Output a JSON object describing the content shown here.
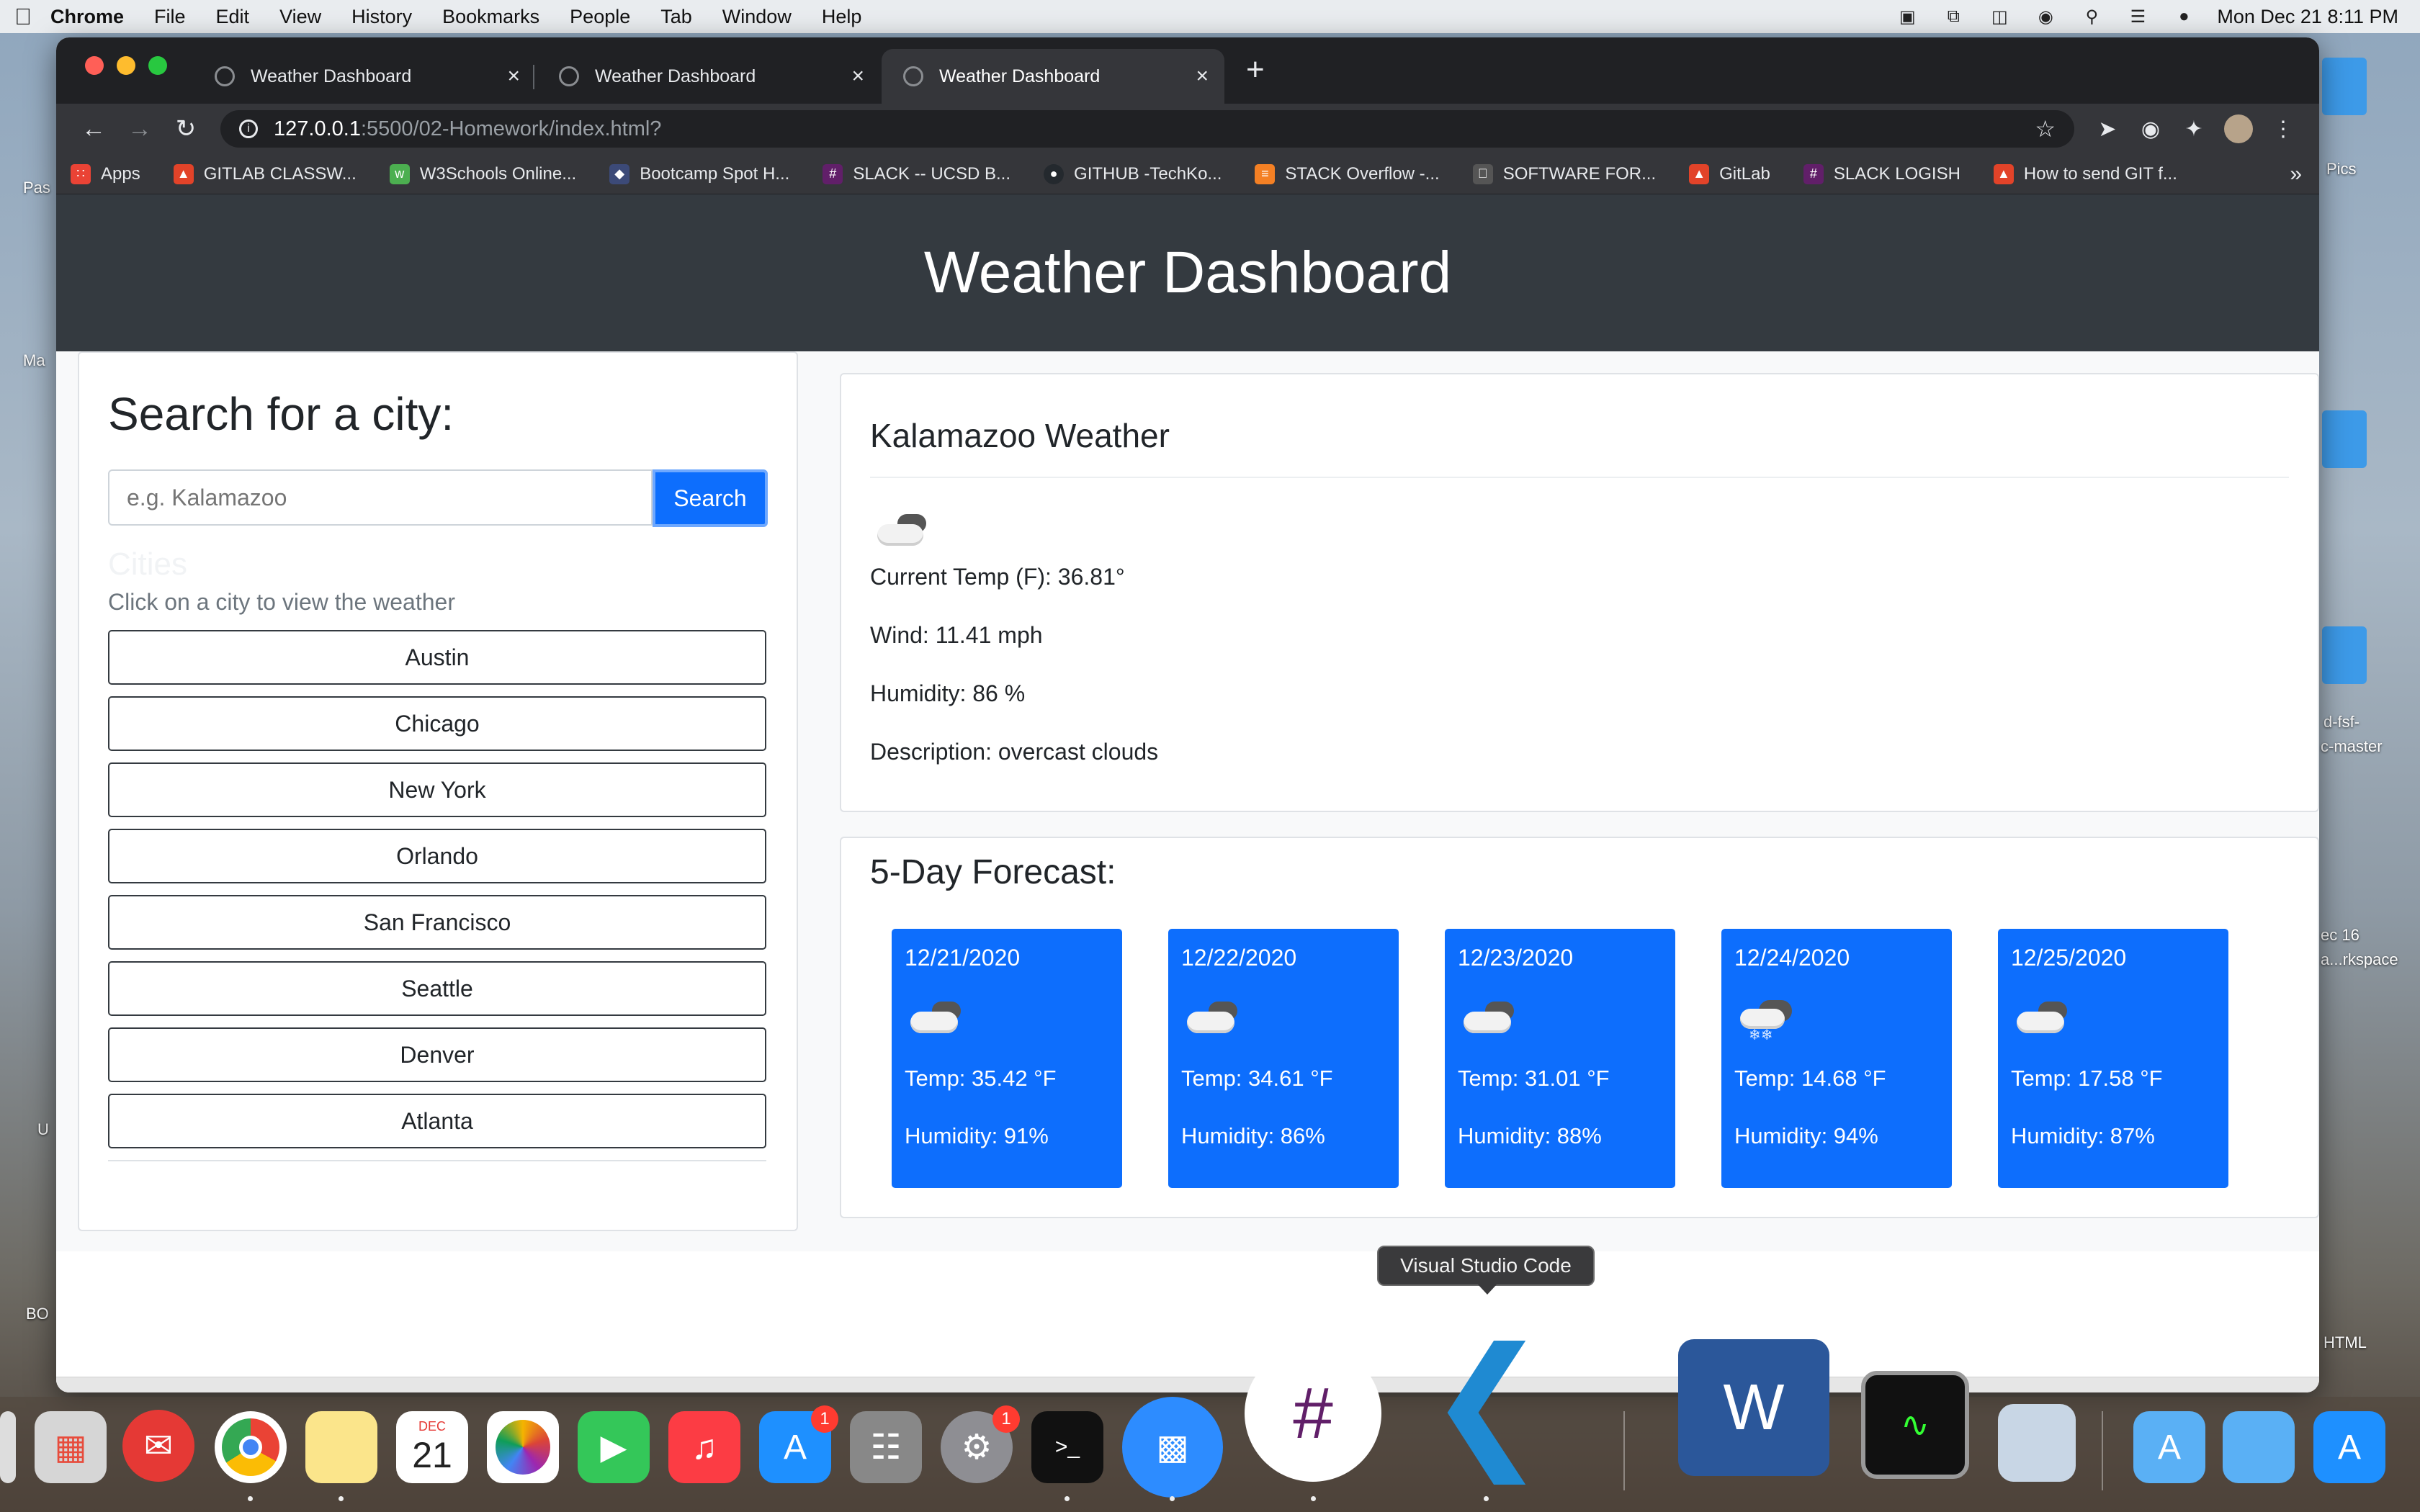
{
  "menubar": {
    "app": "Chrome",
    "items": [
      "File",
      "Edit",
      "View",
      "History",
      "Bookmarks",
      "People",
      "Tab",
      "Window",
      "Help"
    ],
    "clock": "Mon Dec 21  8:11 PM"
  },
  "desktop": {
    "labels": [
      "Pas",
      "Ma",
      "U",
      "BO",
      "Pics",
      "d-fsf-",
      "c-master",
      "ec 16",
      "a...rkspace",
      "HTML"
    ]
  },
  "browser": {
    "tabs": [
      {
        "title": "Weather Dashboard"
      },
      {
        "title": "Weather Dashboard"
      },
      {
        "title": "Weather Dashboard"
      }
    ],
    "url_host": "127.0.0.1",
    "url_path": ":5500/02-Homework/index.html?",
    "bookmarks": [
      {
        "label": "Apps",
        "icon": "apps-grid-icon",
        "color": "#ea4335"
      },
      {
        "label": "GITLAB CLASSW...",
        "icon": "gitlab-icon",
        "color": "#e24329"
      },
      {
        "label": "W3Schools Online...",
        "icon": "w3schools-icon",
        "color": "#4caf50"
      },
      {
        "label": "Bootcamp Spot H...",
        "icon": "shield-icon",
        "color": "#3c4a78"
      },
      {
        "label": "SLACK -- UCSD B...",
        "icon": "slack-icon",
        "color": "#611f69"
      },
      {
        "label": "GITHUB -TechKo...",
        "icon": "github-icon",
        "color": "#24292e"
      },
      {
        "label": "STACK Overflow -...",
        "icon": "stackoverflow-icon",
        "color": "#f48024"
      },
      {
        "label": "SOFTWARE FOR...",
        "icon": "apple-icon",
        "color": "#555555"
      },
      {
        "label": "GitLab",
        "icon": "gitlab-icon",
        "color": "#e24329"
      },
      {
        "label": "SLACK LOGISH",
        "icon": "slack-icon",
        "color": "#611f69"
      },
      {
        "label": "How to send GIT f...",
        "icon": "gitlab-icon",
        "color": "#e24329"
      }
    ]
  },
  "page": {
    "header_title": "Weather Dashboard",
    "search": {
      "title": "Search for a city:",
      "placeholder": "e.g. Kalamazoo",
      "button_label": "Search",
      "cities_heading": "Cities",
      "help_text": "Click on a city to view the weather",
      "cities": [
        "Austin",
        "Chicago",
        "New York",
        "Orlando",
        "San Francisco",
        "Seattle",
        "Denver",
        "Atlanta"
      ]
    },
    "current": {
      "title": "Kalamazoo Weather",
      "icon": "overcast-clouds-icon",
      "temp": "Current Temp (F): 36.81°",
      "wind": "Wind: 11.41 mph",
      "humidity": "Humidity: 86 %",
      "description": "Description: overcast clouds"
    },
    "forecast": {
      "title": "5-Day Forecast:",
      "days": [
        {
          "date": "12/21/2020",
          "icon": "overcast-clouds-icon",
          "temp": "Temp: 35.42 °F",
          "humidity": "Humidity: 91%"
        },
        {
          "date": "12/22/2020",
          "icon": "overcast-clouds-icon",
          "temp": "Temp: 34.61 °F",
          "humidity": "Humidity: 86%"
        },
        {
          "date": "12/23/2020",
          "icon": "overcast-clouds-icon",
          "temp": "Temp: 31.01 °F",
          "humidity": "Humidity: 88%"
        },
        {
          "date": "12/24/2020",
          "icon": "snow-icon",
          "temp": "Temp: 14.68 °F",
          "humidity": "Humidity: 94%"
        },
        {
          "date": "12/25/2020",
          "icon": "overcast-clouds-icon",
          "temp": "Temp: 17.58 °F",
          "humidity": "Humidity: 87%"
        }
      ]
    }
  },
  "tooltip": "Visual Studio Code",
  "dock": {
    "calendar_month": "DEC",
    "calendar_day": "21",
    "badges": {
      "app_store": "1",
      "system_prefs": "1"
    },
    "apps": [
      "launchpad-icon",
      "mail-icon",
      "chrome-icon",
      "notes-icon",
      "calendar-icon",
      "photos-icon",
      "facetime-icon",
      "music-icon",
      "app-store-icon",
      "calculator-icon",
      "system-preferences-icon",
      "terminal-icon",
      "zoom-icon",
      "slack-icon",
      "vscode-icon",
      "word-icon",
      "activity-monitor-icon",
      "preview-icon",
      "applications-folder-icon",
      "downloads-folder-icon",
      "app-store-icon"
    ]
  }
}
